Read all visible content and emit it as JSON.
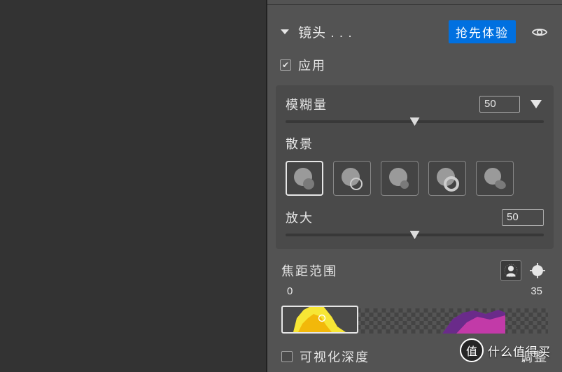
{
  "section": {
    "title": "镜头 . . .",
    "earlyAccess": "抢先体验"
  },
  "apply": {
    "label": "应用",
    "checked": true
  },
  "blur": {
    "label": "模糊量",
    "value": "50",
    "pct": 50
  },
  "bokeh": {
    "label": "散景",
    "selected": 0
  },
  "zoom": {
    "label": "放大",
    "value": "50",
    "pct": 50
  },
  "focus": {
    "label": "焦距范围",
    "min": "0",
    "max": "35"
  },
  "depth": {
    "label": "可视化深度",
    "checked": false,
    "adjustLabel": "调整"
  },
  "watermark": {
    "badge": "值",
    "text": "什么值得买"
  }
}
